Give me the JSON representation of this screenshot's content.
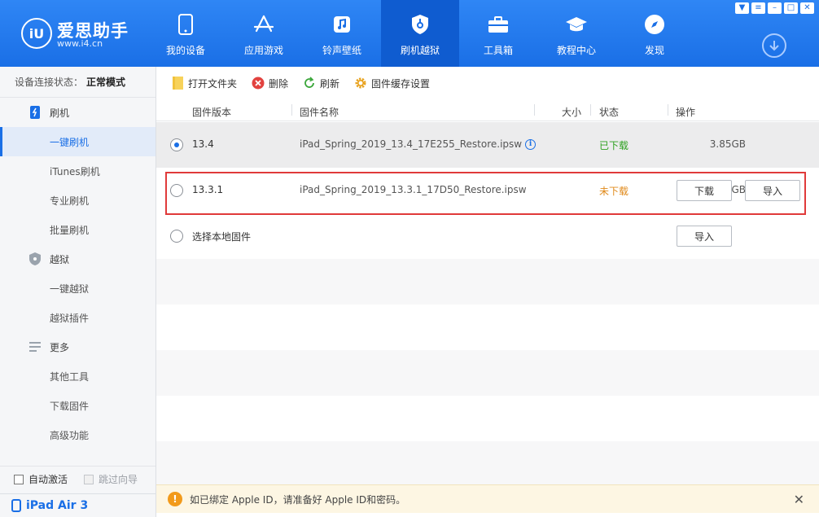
{
  "app": {
    "title": "爱思助手",
    "url": "www.i4.cn",
    "logo_mark": "iU"
  },
  "nav": [
    {
      "label": "我的设备",
      "icon": "phone-icon"
    },
    {
      "label": "应用游戏",
      "icon": "app-store-icon"
    },
    {
      "label": "铃声壁纸",
      "icon": "music-icon"
    },
    {
      "label": "刷机越狱",
      "icon": "shield-key-icon",
      "active": true
    },
    {
      "label": "工具箱",
      "icon": "toolbox-icon"
    },
    {
      "label": "教程中心",
      "icon": "graduation-cap-icon"
    },
    {
      "label": "发现",
      "icon": "compass-icon"
    }
  ],
  "window_controls": [
    "▼",
    "≡",
    "–",
    "□",
    "✕"
  ],
  "sidebar": {
    "status_label": "设备连接状态：",
    "status_value": "正常模式",
    "groups": [
      {
        "label": "刷机",
        "icon": "flash-phone-icon"
      },
      {
        "label": "越狱",
        "icon": "shield-icon"
      },
      {
        "label": "更多",
        "icon": "menu-lines-icon"
      }
    ],
    "items": [
      "一键刷机",
      "iTunes刷机",
      "专业刷机",
      "批量刷机",
      "一键越狱",
      "越狱插件",
      "其他工具",
      "下载固件",
      "高级功能"
    ],
    "auto_activate": "自动激活",
    "skip_guide": "跳过向导",
    "device": "iPad Air 3"
  },
  "toolbar": {
    "open_folder": "打开文件夹",
    "delete": "删除",
    "refresh": "刷新",
    "cache_settings": "固件缓存设置"
  },
  "table": {
    "headers": {
      "version": "固件版本",
      "name": "固件名称",
      "size": "大小",
      "status": "状态",
      "action": "操作"
    },
    "rows": [
      {
        "version": "13.4",
        "name": "iPad_Spring_2019_13.4_17E255_Restore.ipsw",
        "size": "3.85GB",
        "status": "已下载",
        "selected": true
      },
      {
        "version": "13.3.1",
        "name": "iPad_Spring_2019_13.3.1_17D50_Restore.ipsw",
        "size": "3.77GB",
        "status": "未下载",
        "download": "下载",
        "import": "导入"
      },
      {
        "version": "选择本地固件",
        "import": "导入"
      }
    ]
  },
  "notice": {
    "text": "如已绑定 Apple ID，请准备好 Apple ID和密码。",
    "close": "✕"
  },
  "colors": {
    "brand": "#1a6fe6",
    "downloaded": "#2ea121",
    "not_downloaded": "#e08a1b",
    "highlight": "#e03a3a"
  }
}
